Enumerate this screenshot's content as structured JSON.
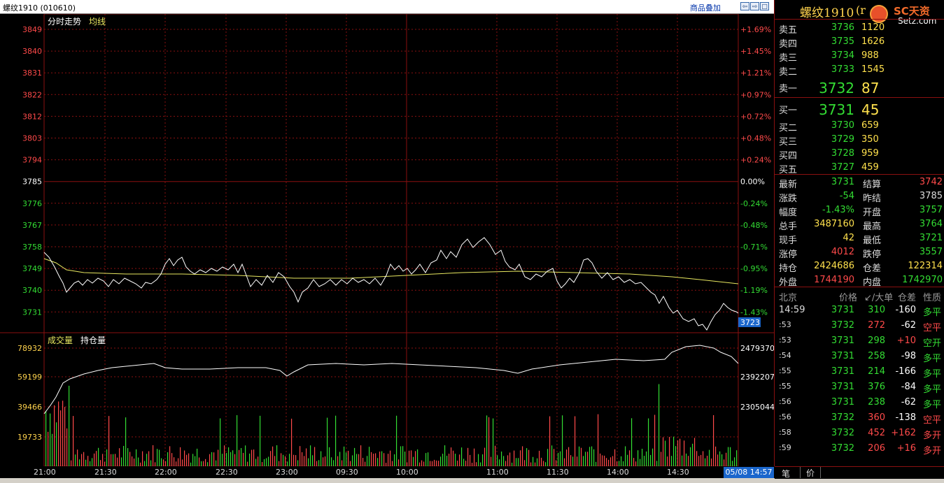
{
  "header": {
    "title": "螺纹1910 (010610)",
    "overlay_button": "商品叠加",
    "btn_left": "⇦",
    "btn_right": "⇨",
    "btn_box": "□",
    "btn_more": "▸"
  },
  "price_chart": {
    "label_trend": "分时走势",
    "label_avg": "均线",
    "y_left": [
      "3849",
      "3840",
      "3831",
      "3822",
      "3812",
      "3803",
      "3794",
      "3785",
      "3776",
      "3767",
      "3758",
      "3749",
      "3740",
      "3731"
    ],
    "y_right": [
      "+1.69%",
      "+1.45%",
      "+1.21%",
      "+0.97%",
      "+0.72%",
      "+0.48%",
      "+0.24%",
      "0.00%",
      "-0.24%",
      "-0.48%",
      "-0.71%",
      "-0.95%",
      "-1.19%",
      "-1.43%"
    ],
    "last_price_tag": "3723"
  },
  "volume_chart": {
    "label_volume": "成交量",
    "label_oi": "持仓量",
    "y_left": [
      "78932",
      "59199",
      "39466",
      "19733"
    ],
    "y_right": [
      "2479370",
      "2392207",
      "2305044"
    ]
  },
  "time_axis": [
    "21:00",
    "21:30",
    "22:00",
    "22:30",
    "23:00",
    "09:30",
    "10:00",
    "11:00",
    "11:30",
    "14:00",
    "14:30"
  ],
  "datetime_badge": "05/08 14:57",
  "quote_panel": {
    "title": "螺纹1910",
    "title_suffix": "(r",
    "logo_text": "SC天资",
    "logo_sub": "Setz.com",
    "asks": [
      {
        "label": "卖五",
        "price": "3736",
        "vol": "1120"
      },
      {
        "label": "卖四",
        "price": "3735",
        "vol": "1626"
      },
      {
        "label": "卖三",
        "price": "3734",
        "vol": "988"
      },
      {
        "label": "卖二",
        "price": "3733",
        "vol": "1545"
      }
    ],
    "ask1": {
      "label": "卖一",
      "price": "3732",
      "vol": "87"
    },
    "bid1": {
      "label": "买一",
      "price": "3731",
      "vol": "45"
    },
    "bids": [
      {
        "label": "买二",
        "price": "3730",
        "vol": "659"
      },
      {
        "label": "买三",
        "price": "3729",
        "vol": "350"
      },
      {
        "label": "买四",
        "price": "3728",
        "vol": "959"
      },
      {
        "label": "买五",
        "price": "3727",
        "vol": "459"
      }
    ],
    "stats": [
      {
        "l1": "最新",
        "v1": "3731",
        "l2": "结算",
        "v2": "3742"
      },
      {
        "l1": "涨跌",
        "v1": "-54",
        "l2": "昨结",
        "v2": "3785"
      },
      {
        "l1": "幅度",
        "v1": "-1.43%",
        "l2": "开盘",
        "v2": "3757"
      },
      {
        "l1": "总手",
        "v1": "3487160",
        "l2": "最高",
        "v2": "3764"
      },
      {
        "l1": "现手",
        "v1": "42",
        "l2": "最低",
        "v2": "3721"
      },
      {
        "l1": "涨停",
        "v1": "4012",
        "l2": "跌停",
        "v2": "3557"
      },
      {
        "l1": "持仓",
        "v1": "2424686",
        "l2": "仓差",
        "v2": "122314"
      },
      {
        "l1": "外盘",
        "v1": "1744190",
        "l2": "内盘",
        "v2": "1742970"
      }
    ],
    "ticks_header": {
      "c0": "北京",
      "c1": "价格",
      "c2": "↙/大单",
      "c3": "仓差",
      "c4": "性质"
    },
    "ticks": [
      {
        "time": "14:59",
        "price": "3731",
        "vol": "310",
        "diff": "-160",
        "nature": "多平",
        "vc": "green"
      },
      {
        "time": ":53",
        "price": "3732",
        "vol": "272",
        "diff": "-62",
        "nature": "空平",
        "vc": "red"
      },
      {
        "time": ":53",
        "price": "3731",
        "vol": "298",
        "diff": "+10",
        "nature": "空开",
        "vc": "green"
      },
      {
        "time": ":54",
        "price": "3731",
        "vol": "258",
        "diff": "-98",
        "nature": "多平",
        "vc": "green"
      },
      {
        "time": ":55",
        "price": "3731",
        "vol": "214",
        "diff": "-166",
        "nature": "多平",
        "vc": "green"
      },
      {
        "time": ":55",
        "price": "3731",
        "vol": "376",
        "diff": "-84",
        "nature": "多平",
        "vc": "green"
      },
      {
        "time": ":56",
        "price": "3731",
        "vol": "238",
        "diff": "-62",
        "nature": "多平",
        "vc": "green"
      },
      {
        "time": ":56",
        "price": "3732",
        "vol": "360",
        "diff": "-138",
        "nature": "空平",
        "vc": "red"
      },
      {
        "time": ":58",
        "price": "3732",
        "vol": "452",
        "diff": "+162",
        "nature": "多开",
        "vc": "red"
      },
      {
        "time": ":59",
        "price": "3732",
        "vol": "206",
        "diff": "+16",
        "nature": "多开",
        "vc": "red"
      }
    ],
    "tab_trades": "笔",
    "tab_price": "价"
  },
  "colors": {
    "grid": "#8a1010",
    "price_line": "#ffffff",
    "avg_line": "#e8e860",
    "up": "#ff4a4a",
    "down": "#33dd33",
    "neutral": "#ffffff",
    "label_yellow": "#ffd34d"
  }
}
